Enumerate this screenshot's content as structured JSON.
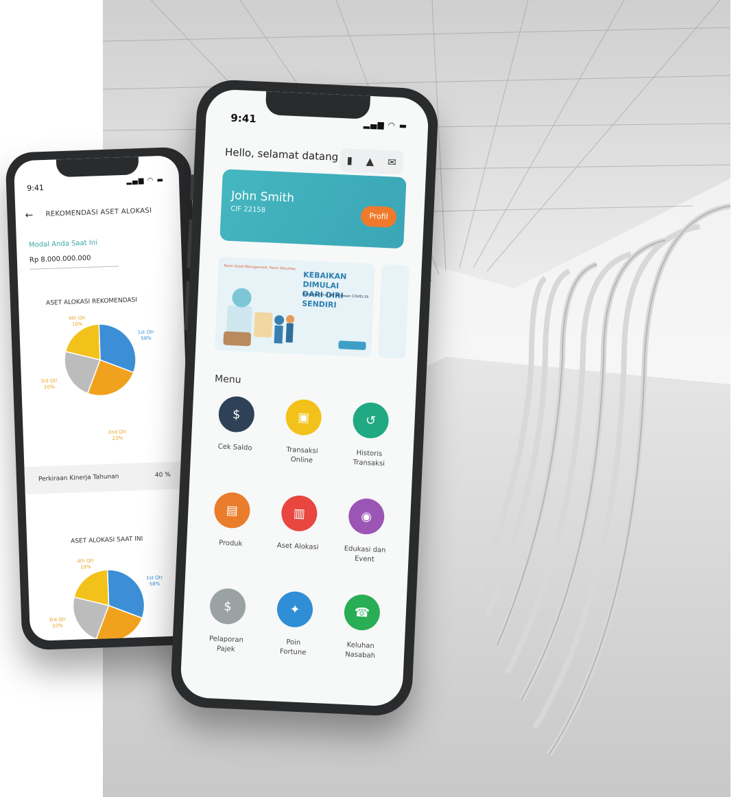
{
  "back_phone": {
    "time": "9:41",
    "status_icons": "▂▄▆ ◠ ▬",
    "back_icon": "←",
    "title": "REKOMENDASI ASET ALOKASI",
    "modal_label": "Modal Anda Saat Ini",
    "modal_value": "Rp 8.000.000.000",
    "chart1": {
      "title": "ASET ALOKASI REKOMENDASI",
      "labels": [
        {
          "name": "4th Qtr",
          "pct": "10%"
        },
        {
          "name": "1st Qtr",
          "pct": "58%"
        },
        {
          "name": "3rd Qtr",
          "pct": "10%"
        },
        {
          "name": "2nd Qtr",
          "pct": "23%"
        }
      ]
    },
    "performance_label": "Perkiraan Kinerja Tahunan",
    "performance_value": "40 %",
    "chart2": {
      "title": "ASET ALOKASI SAAT INI",
      "labels": [
        {
          "name": "4th Qtr",
          "pct": "10%"
        },
        {
          "name": "1st Qtr",
          "pct": "58%"
        },
        {
          "name": "3rd Qtr",
          "pct": "10%"
        }
      ]
    }
  },
  "front_phone": {
    "time": "9:41",
    "status_icons": "▂▄▆ ◠ ▬",
    "greeting": "Hello, selamat datang",
    "header_icons": [
      "chart-icon",
      "bell-icon",
      "mail-icon"
    ],
    "profile_card": {
      "name": "John Smith",
      "cif": "CIF 22158",
      "profile_button": "Profil"
    },
    "banner": {
      "logo_left": "Panin Asset Management",
      "logo_right": "Panin Sekuritas",
      "headline_line1": "KEBAIKAN DIMULAI",
      "headline_line2": "DARI DIRI SENDIRI",
      "subheadline": "Bersama Panin AM Melawan COVID-19"
    },
    "menu_title": "Menu",
    "menu": [
      {
        "label1": "Cek Saldo",
        "label2": "",
        "color": "#2e4156",
        "icon": "wallet-icon",
        "glyph": "$"
      },
      {
        "label1": "Transaksi",
        "label2": "Online",
        "color": "#f2c21b",
        "icon": "shopping-bag-icon",
        "glyph": "▣"
      },
      {
        "label1": "Historis",
        "label2": "Transaksi",
        "color": "#20a982",
        "icon": "history-icon",
        "glyph": "↺"
      },
      {
        "label1": "Produk",
        "label2": "",
        "color": "#ea7d2c",
        "icon": "product-icon",
        "glyph": "▤"
      },
      {
        "label1": "Aset Alokasi",
        "label2": "",
        "color": "#e8463e",
        "icon": "document-icon",
        "glyph": "▥"
      },
      {
        "label1": "Edukasi dan",
        "label2": "Event",
        "color": "#9b55b4",
        "icon": "education-icon",
        "glyph": "◉"
      },
      {
        "label1": "Pelaporan",
        "label2": "Pajek",
        "color": "#9aa2a4",
        "icon": "tax-report-icon",
        "glyph": "$"
      },
      {
        "label1": "Poin",
        "label2": "Fortune",
        "color": "#2f8ed6",
        "icon": "award-icon",
        "glyph": "✦"
      },
      {
        "label1": "Keluhan",
        "label2": "Nasabah",
        "color": "#29ad55",
        "icon": "headset-icon",
        "glyph": "☎"
      }
    ]
  }
}
